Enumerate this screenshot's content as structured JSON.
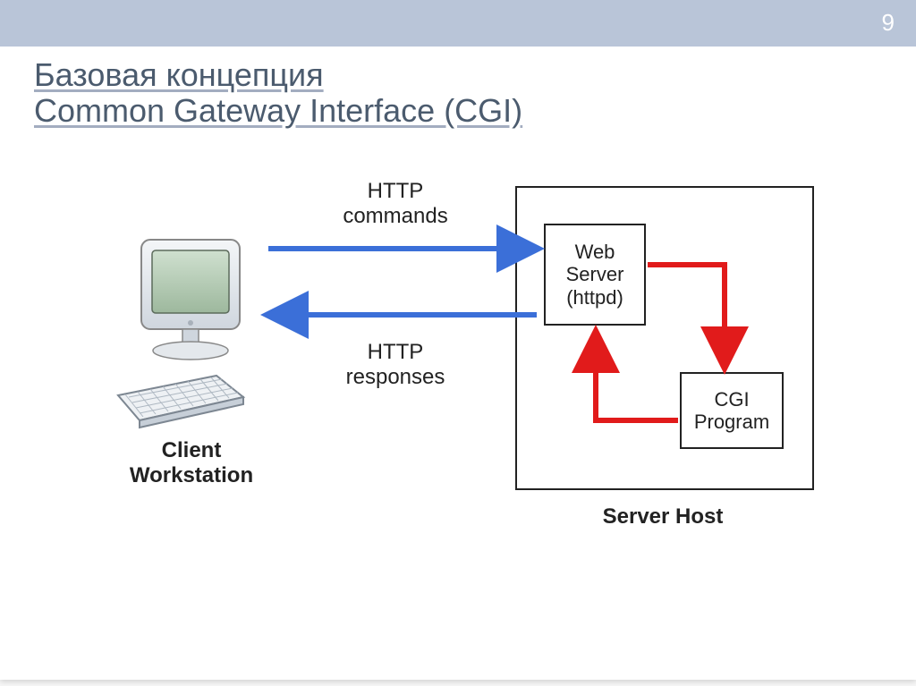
{
  "slide_number": "9",
  "title_line1": "Базовая концепция",
  "title_line2": "Common Gateway Interface (CGI)",
  "labels": {
    "http_commands_l1": "HTTP",
    "http_commands_l2": "commands",
    "http_responses_l1": "HTTP",
    "http_responses_l2": "responses",
    "client_l1": "Client",
    "client_l2": "Workstation",
    "server_host": "Server Host"
  },
  "components": {
    "web_l1": "Web",
    "web_l2": "Server",
    "web_l3": "(httpd)",
    "cgi_l1": "CGI",
    "cgi_l2": "Program"
  },
  "colors": {
    "accent_bar": "#b9c5d8",
    "title_text": "#4b5b6e",
    "blue_arrow": "#3b6fd8",
    "red_arrow": "#e11b1b"
  }
}
